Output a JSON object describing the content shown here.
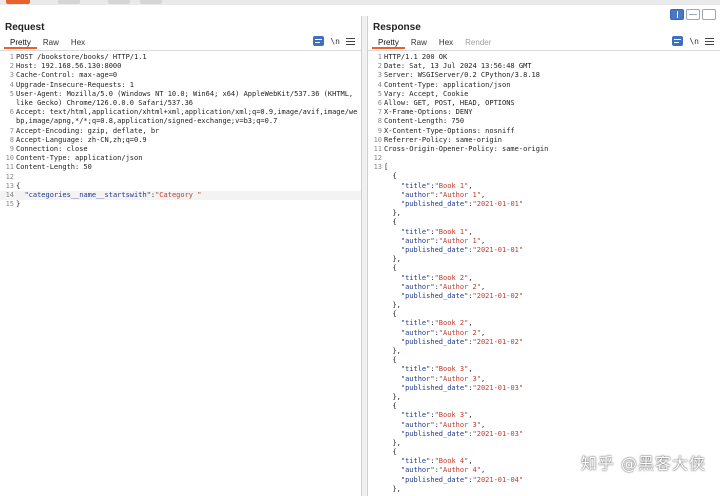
{
  "request": {
    "title": "Request",
    "tabs": [
      "Pretty",
      "Raw",
      "Hex"
    ],
    "active_tab": "Pretty",
    "newline_toggle": "\\n",
    "lines": [
      {
        "n": "1",
        "text": "POST /bookstore/books/ HTTP/1.1"
      },
      {
        "n": "2",
        "text": "Host: 192.168.56.130:8000"
      },
      {
        "n": "3",
        "text": "Cache-Control: max-age=0"
      },
      {
        "n": "4",
        "text": "Upgrade-Insecure-Requests: 1"
      },
      {
        "n": "5",
        "text": "User-Agent: Mozilla/5.0 (Windows NT 10.0; Win64; x64) AppleWebKit/537.36 (KHTML, like Gecko) Chrome/126.0.0.0 Safari/537.36"
      },
      {
        "n": "6",
        "text": "Accept: text/html,application/xhtml+xml,application/xml;q=0.9,image/avif,image/webp,image/apng,*/*;q=0.8,application/signed-exchange;v=b3;q=0.7"
      },
      {
        "n": "7",
        "text": "Accept-Encoding: gzip, deflate, br"
      },
      {
        "n": "8",
        "text": "Accept-Language: zh-CN,zh;q=0.9"
      },
      {
        "n": "9",
        "text": "Connection: close"
      },
      {
        "n": "10",
        "text": "Content-Type: application/json"
      },
      {
        "n": "11",
        "text": "Content-Length: 50"
      },
      {
        "n": "12",
        "text": ""
      },
      {
        "n": "13",
        "text": "{"
      },
      {
        "n": "14",
        "key": "\"categories__name__startswith\"",
        "sep": ":",
        "val": "\"Category \""
      },
      {
        "n": "15",
        "text": "}"
      }
    ]
  },
  "response": {
    "title": "Response",
    "tabs": [
      "Pretty",
      "Raw",
      "Hex",
      "Render"
    ],
    "active_tab": "Pretty",
    "newline_toggle": "\\n",
    "header_lines": [
      {
        "n": "1",
        "text": "HTTP/1.1 200 OK"
      },
      {
        "n": "2",
        "text": "Date: Sat, 13 Jul 2024 13:56:48 GMT"
      },
      {
        "n": "3",
        "text": "Server: WSGIServer/0.2 CPython/3.8.18"
      },
      {
        "n": "4",
        "text": "Content-Type: application/json"
      },
      {
        "n": "5",
        "text": "Vary: Accept, Cookie"
      },
      {
        "n": "6",
        "text": "Allow: GET, POST, HEAD, OPTIONS"
      },
      {
        "n": "7",
        "text": "X-Frame-Options: DENY"
      },
      {
        "n": "8",
        "text": "Content-Length: 750"
      },
      {
        "n": "9",
        "text": "X-Content-Type-Options: nosniff"
      },
      {
        "n": "10",
        "text": "Referrer-Policy: same-origin"
      },
      {
        "n": "11",
        "text": "Cross-Origin-Opener-Policy: same-origin"
      },
      {
        "n": "12",
        "text": ""
      },
      {
        "n": "13",
        "text": "["
      }
    ],
    "books": [
      {
        "title": "\"Book 1\"",
        "author": "\"Author 1\"",
        "published_date": "\"2021-01-01\""
      },
      {
        "title": "\"Book 1\"",
        "author": "\"Author 1\"",
        "published_date": "\"2021-01-01\""
      },
      {
        "title": "\"Book 2\"",
        "author": "\"Author 2\"",
        "published_date": "\"2021-01-02\""
      },
      {
        "title": "\"Book 2\"",
        "author": "\"Author 2\"",
        "published_date": "\"2021-01-02\""
      },
      {
        "title": "\"Book 3\"",
        "author": "\"Author 3\"",
        "published_date": "\"2021-01-03\""
      },
      {
        "title": "\"Book 3\"",
        "author": "\"Author 3\"",
        "published_date": "\"2021-01-03\""
      },
      {
        "title": "\"Book 4\"",
        "author": "\"Author 4\"",
        "published_date": "\"2021-01-04\""
      }
    ],
    "keys": {
      "title": "\"title\"",
      "author": "\"author\"",
      "published_date": "\"published_date\""
    },
    "open_brace": "{",
    "close_brace": "},"
  },
  "watermark": "知乎 @黑客大侠"
}
